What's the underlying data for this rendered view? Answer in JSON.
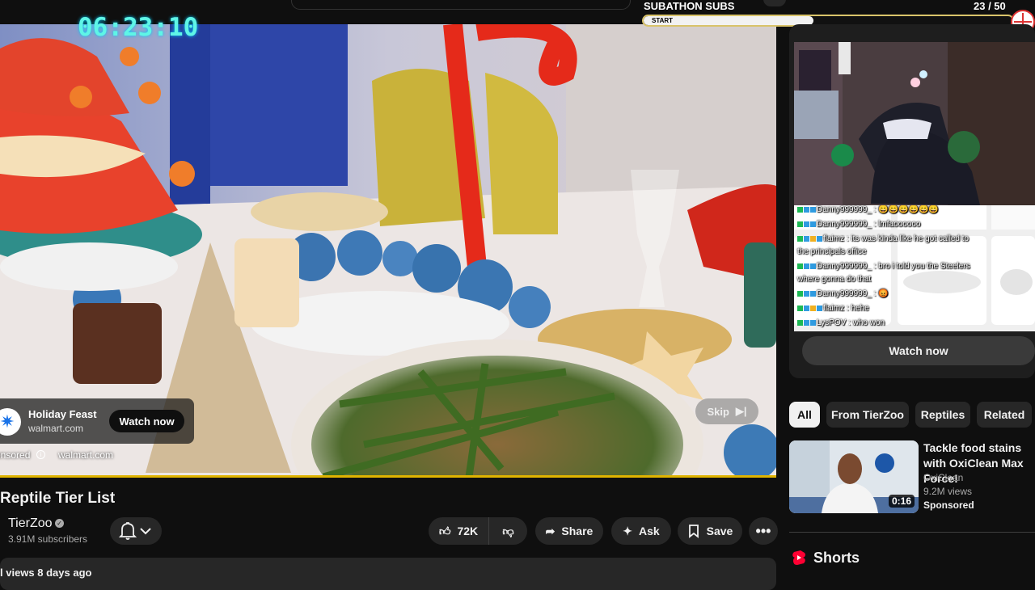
{
  "overlay": {
    "timer": "06:23:10",
    "subathon_title": "SUBATHON SUBS",
    "subathon_count": "23  / 50",
    "subathon_progress": 0.46,
    "subathon_start_label": "START"
  },
  "player": {
    "ad": {
      "title": "Holiday Feast",
      "url": "walmart.com",
      "watch_now_label": "Watch now",
      "sponsored_label": "onsored",
      "sponsored_url": "walmart.com",
      "skip_label": "Skip"
    }
  },
  "video": {
    "title": "Reptile Tier List",
    "channel_name": "TierZoo",
    "subscribers": "3.91M subscribers",
    "likes": "72K",
    "share_label": "Share",
    "ask_label": "Ask",
    "save_label": "Save",
    "meta": "l views  8 days ago"
  },
  "sidebar": {
    "ad_watch_now_label": "Watch now",
    "chat": [
      {
        "user": "Danny999999_",
        "message": " : 😄😄😄😄😄😄"
      },
      {
        "user": "Danny999999_",
        "message": " : lmfaoooooo"
      },
      {
        "user": "flaimz",
        "message": " : its was kinda like he got called to"
      },
      {
        "user": "",
        "message": "the principals office"
      },
      {
        "user": "Danny999999_",
        "message": " : bro i told you the Steelers"
      },
      {
        "user": "",
        "message": "where gonna do that"
      },
      {
        "user": "Danny999999_",
        "message": " : 😡"
      },
      {
        "user": "flaimz",
        "message": " : hehe"
      },
      {
        "user": "LysPOV",
        "message": " : who won"
      }
    ],
    "chips": [
      "All",
      "From TierZoo",
      "Reptiles",
      "Related"
    ],
    "sponsored_video": {
      "title": "Tackle food stains with OxiClean Max Force!",
      "channel": "OxiClean",
      "views": "9.2M views",
      "sponsored_label": "Sponsored",
      "duration": "0:16"
    },
    "shorts_label": "Shorts"
  },
  "colors": {
    "background": "#0f0f0f",
    "timer": "#5ff5e6",
    "progress_bar": "#e0b400",
    "chip_active": "#f1f1f1",
    "shorts_red": "#ff0033"
  }
}
